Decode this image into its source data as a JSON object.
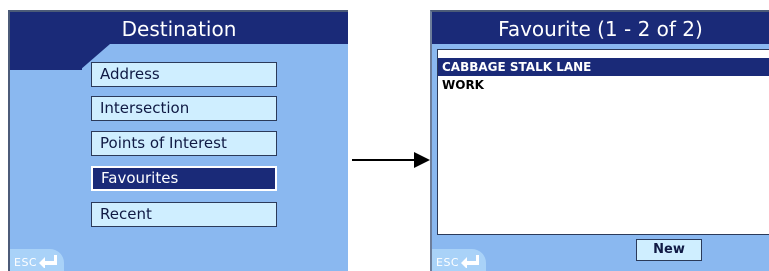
{
  "left_screen": {
    "title": "Destination",
    "menu": [
      {
        "label": "Address",
        "selected": false
      },
      {
        "label": "Intersection",
        "selected": false
      },
      {
        "label": "Points of Interest",
        "selected": false
      },
      {
        "label": "Favourites",
        "selected": true
      },
      {
        "label": "Recent",
        "selected": false
      }
    ],
    "esc_label": "ESC"
  },
  "right_screen": {
    "title": "Favourite (1 - 2 of 2)",
    "favourites": [
      {
        "label": "CABBAGE STALK LANE",
        "selected": true
      },
      {
        "label": "WORK",
        "selected": false
      }
    ],
    "new_label": "New",
    "esc_label": "ESC"
  },
  "colors": {
    "background": "#8ab8f0",
    "header": "#1a2a78",
    "button": "#cfeeff"
  }
}
